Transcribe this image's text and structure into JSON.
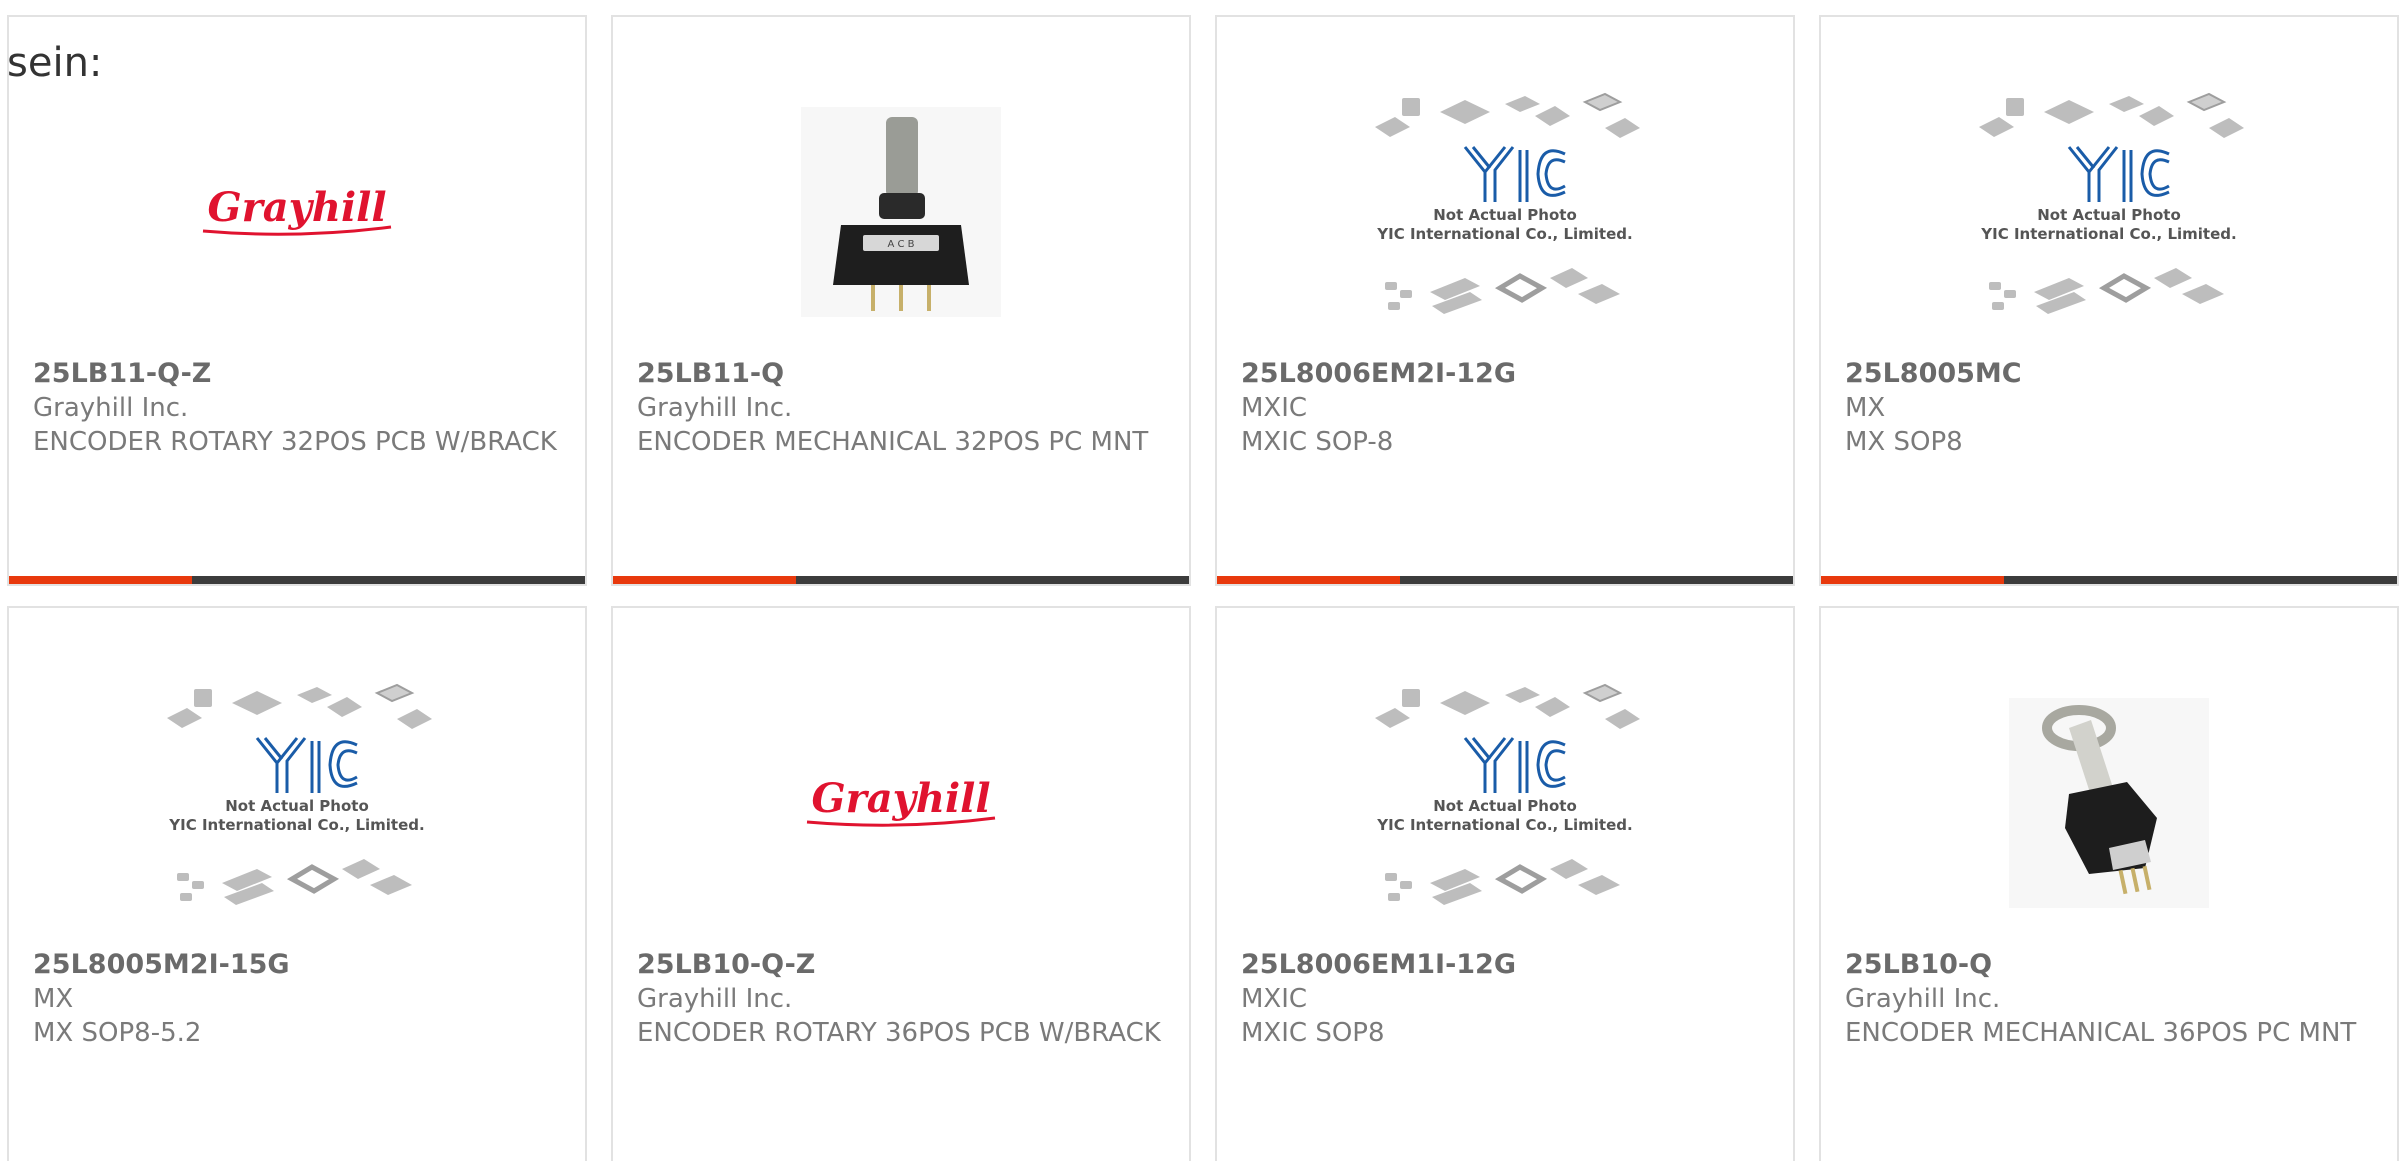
{
  "heading": "sein:",
  "colors": {
    "accent": "#e8390d",
    "bar": "#3c3c3c",
    "border": "#e2e2e2",
    "grayhill_red": "#e0132f",
    "yic_blue": "#1a5ca8"
  },
  "placeholder": {
    "line1": "Not Actual Photo",
    "line2": "YIC International Co., Limited."
  },
  "logo": {
    "grayhill": "Grayhill"
  },
  "products": [
    {
      "part": "25LB11-Q-Z",
      "maker": "Grayhill Inc.",
      "desc": "ENCODER ROTARY 32POS PCB W/BRACK",
      "image": "grayhill-logo"
    },
    {
      "part": "25LB11-Q",
      "maker": "Grayhill Inc.",
      "desc": "ENCODER MECHANICAL 32POS PC MNT",
      "image": "encoder-photo-front"
    },
    {
      "part": "25L8006EM2I-12G",
      "maker": "MXIC",
      "desc": "MXIC SOP-8",
      "image": "yic-placeholder"
    },
    {
      "part": "25L8005MC",
      "maker": "MX",
      "desc": "MX SOP8",
      "image": "yic-placeholder"
    },
    {
      "part": "25L8005M2I-15G",
      "maker": "MX",
      "desc": "MX SOP8-5.2",
      "image": "yic-placeholder"
    },
    {
      "part": "25LB10-Q-Z",
      "maker": "Grayhill Inc.",
      "desc": "ENCODER ROTARY 36POS PCB W/BRACK",
      "image": "grayhill-logo"
    },
    {
      "part": "25L8006EM1I-12G",
      "maker": "MXIC",
      "desc": "MXIC SOP8",
      "image": "yic-placeholder"
    },
    {
      "part": "25LB10-Q",
      "maker": "Grayhill Inc.",
      "desc": "ENCODER MECHANICAL 36POS PC MNT",
      "image": "encoder-photo-angled"
    }
  ]
}
